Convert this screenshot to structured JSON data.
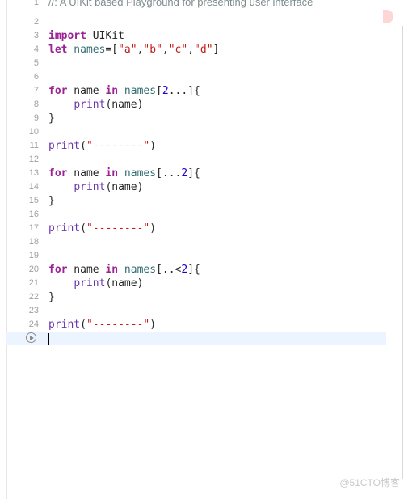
{
  "header_comment": {
    "line_number": "1",
    "text": "//: A UIKit based Playground for presenting user interface"
  },
  "lines": [
    {
      "n": "2"
    },
    {
      "n": "3",
      "kw1": "import",
      "rest": " UIKit"
    },
    {
      "n": "4",
      "kw1": "let",
      "var1": " names",
      "rest": "=[",
      "s1": "\"a\"",
      "c1": ",",
      "s2": "\"b\"",
      "c2": ",",
      "s3": "\"c\"",
      "c3": ",",
      "s4": "\"d\"",
      "end": "]"
    },
    {
      "n": "5"
    },
    {
      "n": "6"
    },
    {
      "n": "7",
      "kw1": "for",
      "rest": " name ",
      "kw2": "in",
      "var1": " names",
      "mid": "[",
      "num": "2",
      "tail": "...]{"
    },
    {
      "n": "8",
      "indent": "    ",
      "fn": "print",
      "args": "(name)"
    },
    {
      "n": "9",
      "text": "}"
    },
    {
      "n": "10"
    },
    {
      "n": "11",
      "fn": "print",
      "open": "(",
      "str": "\"--------\"",
      "close": ")"
    },
    {
      "n": "12"
    },
    {
      "n": "13",
      "kw1": "for",
      "rest": " name ",
      "kw2": "in",
      "var1": " names",
      "mid": "[...",
      "num": "2",
      "tail": "]{"
    },
    {
      "n": "14",
      "indent": "    ",
      "fn": "print",
      "args": "(name)"
    },
    {
      "n": "15",
      "text": "}"
    },
    {
      "n": "16"
    },
    {
      "n": "17",
      "fn": "print",
      "open": "(",
      "str": "\"--------\"",
      "close": ")"
    },
    {
      "n": "18"
    },
    {
      "n": "19"
    },
    {
      "n": "20",
      "kw1": "for",
      "rest": " name ",
      "kw2": "in",
      "var1": " names",
      "mid": "[..<",
      "num": "2",
      "tail": "]{"
    },
    {
      "n": "21",
      "indent": "    ",
      "fn": "print",
      "args": "(name)"
    },
    {
      "n": "22",
      "text": "}"
    },
    {
      "n": "23"
    },
    {
      "n": "24",
      "fn": "print",
      "open": "(",
      "str": "\"--------\"",
      "close": ")"
    }
  ],
  "watermark": "@51CTO博客",
  "icons": {
    "run": "run-icon",
    "breakpoint": "breakpoint-marker"
  }
}
